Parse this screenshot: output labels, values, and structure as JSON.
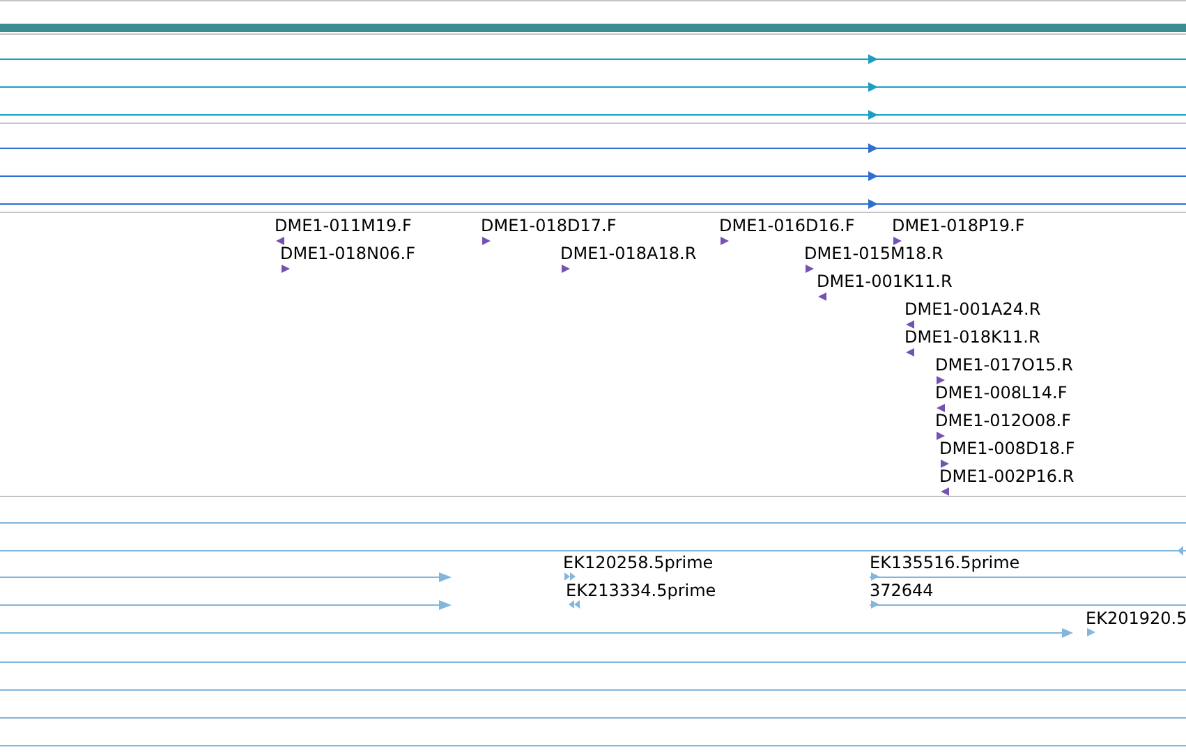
{
  "bac_ends": [
    {
      "label": "DME1-011M19.F",
      "reverse": true
    },
    {
      "label": "DME1-018D17.F",
      "reverse": false
    },
    {
      "label": "DME1-016D16.F",
      "reverse": false
    },
    {
      "label": "DME1-018P19.F",
      "reverse": false
    },
    {
      "label": "DME1-018N06.F",
      "reverse": false
    },
    {
      "label": "DME1-018A18.R",
      "reverse": false
    },
    {
      "label": "DME1-015M18.R",
      "reverse": false
    },
    {
      "label": "DME1-001K11.R",
      "reverse": true
    },
    {
      "label": "DME1-001A24.R",
      "reverse": true
    },
    {
      "label": "DME1-018K11.R",
      "reverse": true
    },
    {
      "label": "DME1-017O15.R",
      "reverse": false
    },
    {
      "label": "DME1-008L14.F",
      "reverse": true
    },
    {
      "label": "DME1-012O08.F",
      "reverse": false
    },
    {
      "label": "DME1-008D18.F",
      "reverse": false
    },
    {
      "label": "DME1-002P16.R",
      "reverse": true
    }
  ],
  "ests": [
    {
      "label": "EK120258.5prime",
      "reverse": false
    },
    {
      "label": "EK135516.5prime",
      "reverse": false
    },
    {
      "label": "EK213334.5prime",
      "reverse": true
    },
    {
      "label": "372644",
      "reverse": false
    },
    {
      "label": "EK201920.5",
      "reverse": false
    }
  ]
}
